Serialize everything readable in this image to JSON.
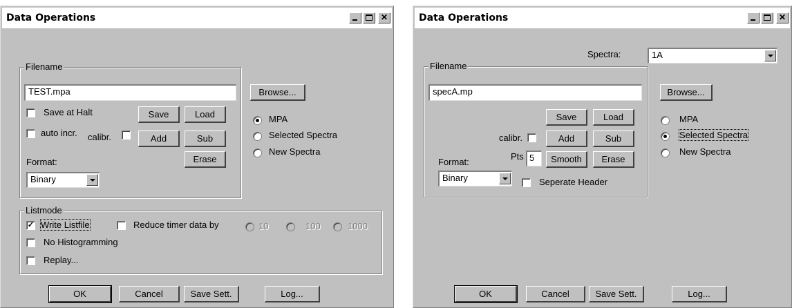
{
  "dialog1": {
    "title": "Data Operations",
    "filename_group": "Filename",
    "filename_value": "TEST.mpa",
    "browse": "Browse...",
    "save_at_halt": "Save at Halt",
    "save": "Save",
    "load": "Load",
    "auto_incr": "auto incr.",
    "calibr": "calibr.",
    "add": "Add",
    "sub": "Sub",
    "format_label": "Format:",
    "erase": "Erase",
    "format_value": "Binary",
    "radio_mpa": "MPA",
    "radio_selected": "Selected Spectra",
    "radio_new": "New Spectra",
    "listmode_group": "Listmode",
    "write_listfile": "Write Listfile",
    "reduce_timer": "Reduce timer data by",
    "r10": "10",
    "r100": "100",
    "r1000": "1000",
    "no_histogramming": "No Histogramming",
    "replay": "Replay...",
    "ok": "OK",
    "cancel": "Cancel",
    "save_sett": "Save Sett.",
    "log": "Log..."
  },
  "dialog2": {
    "title": "Data Operations",
    "spectra_label": "Spectra:",
    "spectra_value": "1A",
    "filename_group": "Filename",
    "filename_value": "specA.mp",
    "browse": "Browse...",
    "save": "Save",
    "load": "Load",
    "calibr": "calibr.",
    "add": "Add",
    "sub": "Sub",
    "format_label": "Format:",
    "pts_label": "Pts",
    "pts_value": "5",
    "smooth": "Smooth",
    "erase": "Erase",
    "format_value": "Binary",
    "separate_header": "Seperate Header",
    "radio_mpa": "MPA",
    "radio_selected": "Selected Spectra",
    "radio_new": "New Spectra",
    "ok": "OK",
    "cancel": "Cancel",
    "save_sett": "Save Sett.",
    "log": "Log..."
  }
}
